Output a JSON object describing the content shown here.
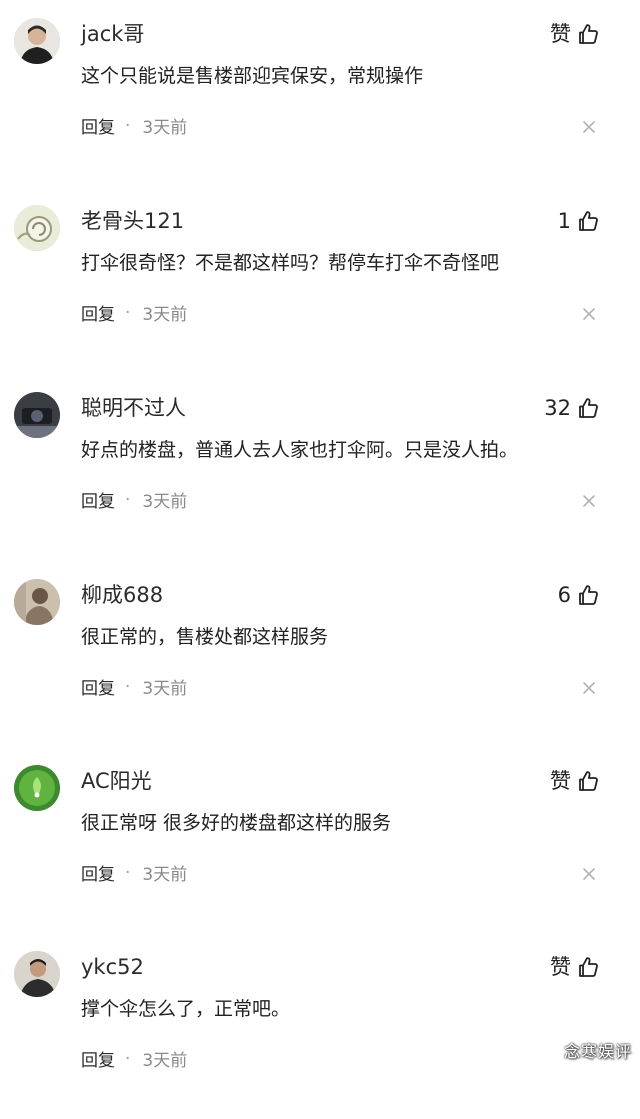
{
  "comments": [
    {
      "username": "jack哥",
      "like_label": "赞",
      "content": "这个只能说是售楼部迎宾保安，常规操作",
      "reply_label": "回复",
      "separator": "·",
      "time": "3天前"
    },
    {
      "username": "老骨头121",
      "like_label": "1",
      "content": "打伞很奇怪？不是都这样吗？帮停车打伞不奇怪吧",
      "reply_label": "回复",
      "separator": "·",
      "time": "3天前"
    },
    {
      "username": "聪明不过人",
      "like_label": "32",
      "content": "好点的楼盘，普通人去人家也打伞阿。只是没人拍。",
      "reply_label": "回复",
      "separator": "·",
      "time": "3天前"
    },
    {
      "username": "柳成688",
      "like_label": "6",
      "content": "很正常的，售楼处都这样服务",
      "reply_label": "回复",
      "separator": "·",
      "time": "3天前"
    },
    {
      "username": "AC阳光",
      "like_label": "赞",
      "content": "很正常呀 很多好的楼盘都这样的服务",
      "reply_label": "回复",
      "separator": "·",
      "time": "3天前"
    },
    {
      "username": "ykc52",
      "like_label": "赞",
      "content": "撑个伞怎么了，正常吧。",
      "reply_label": "回复",
      "separator": "·",
      "time": "3天前"
    }
  ],
  "watermark": "念寒娱评",
  "colors": {
    "text": "#222222",
    "secondary": "#8a8a8a",
    "close": "#b3b3b3",
    "background": "#ffffff"
  }
}
